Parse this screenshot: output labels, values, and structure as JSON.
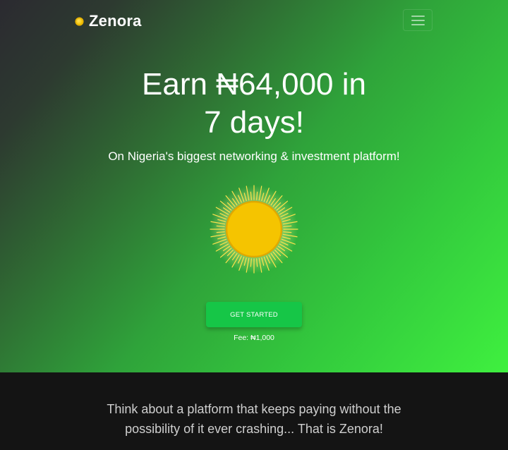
{
  "brand": {
    "name": "Zenora",
    "logo_icon": "sun-dot-icon"
  },
  "navbar": {
    "menu_icon": "hamburger-menu-icon"
  },
  "hero": {
    "headline_line1": "Earn ₦64,000 in",
    "headline_line2": "7 days!",
    "subheadline": "On Nigeria's biggest networking & investment platform!",
    "illustration_icon": "sun-icon",
    "cta_label": "GET STARTED",
    "fee_text": "Fee: ₦1,000"
  },
  "about": {
    "tagline_line1": "Think about a platform that keeps paying without the",
    "tagline_line2": "possibility of it ever crashing... That is Zenora!"
  },
  "colors": {
    "accent_green": "#16c647",
    "sun_yellow": "#f5c400",
    "dark_background": "#141414"
  }
}
